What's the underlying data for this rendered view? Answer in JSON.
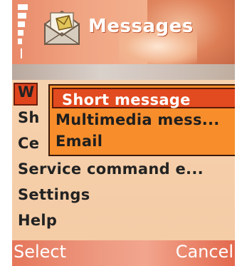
{
  "header": {
    "title": "Messages",
    "app_icon": "envelope-icon",
    "status_icon": "signal-strength-icon"
  },
  "list": {
    "items": [
      {
        "label": "W",
        "selected": true
      },
      {
        "label": "Sh"
      },
      {
        "label": "Ce"
      },
      {
        "label": "Service command e..."
      },
      {
        "label": "Settings"
      },
      {
        "label": "Help"
      }
    ]
  },
  "popup": {
    "options": [
      {
        "label": "Short message",
        "selected": true
      },
      {
        "label": "Multimedia mess..."
      },
      {
        "label": "Email"
      }
    ]
  },
  "softkeys": {
    "left": "Select",
    "right": "Cancel"
  },
  "colors": {
    "highlight": "#e24a1f",
    "popup_bg": "#f78d2b",
    "list_bg": "#f5cfaa"
  }
}
